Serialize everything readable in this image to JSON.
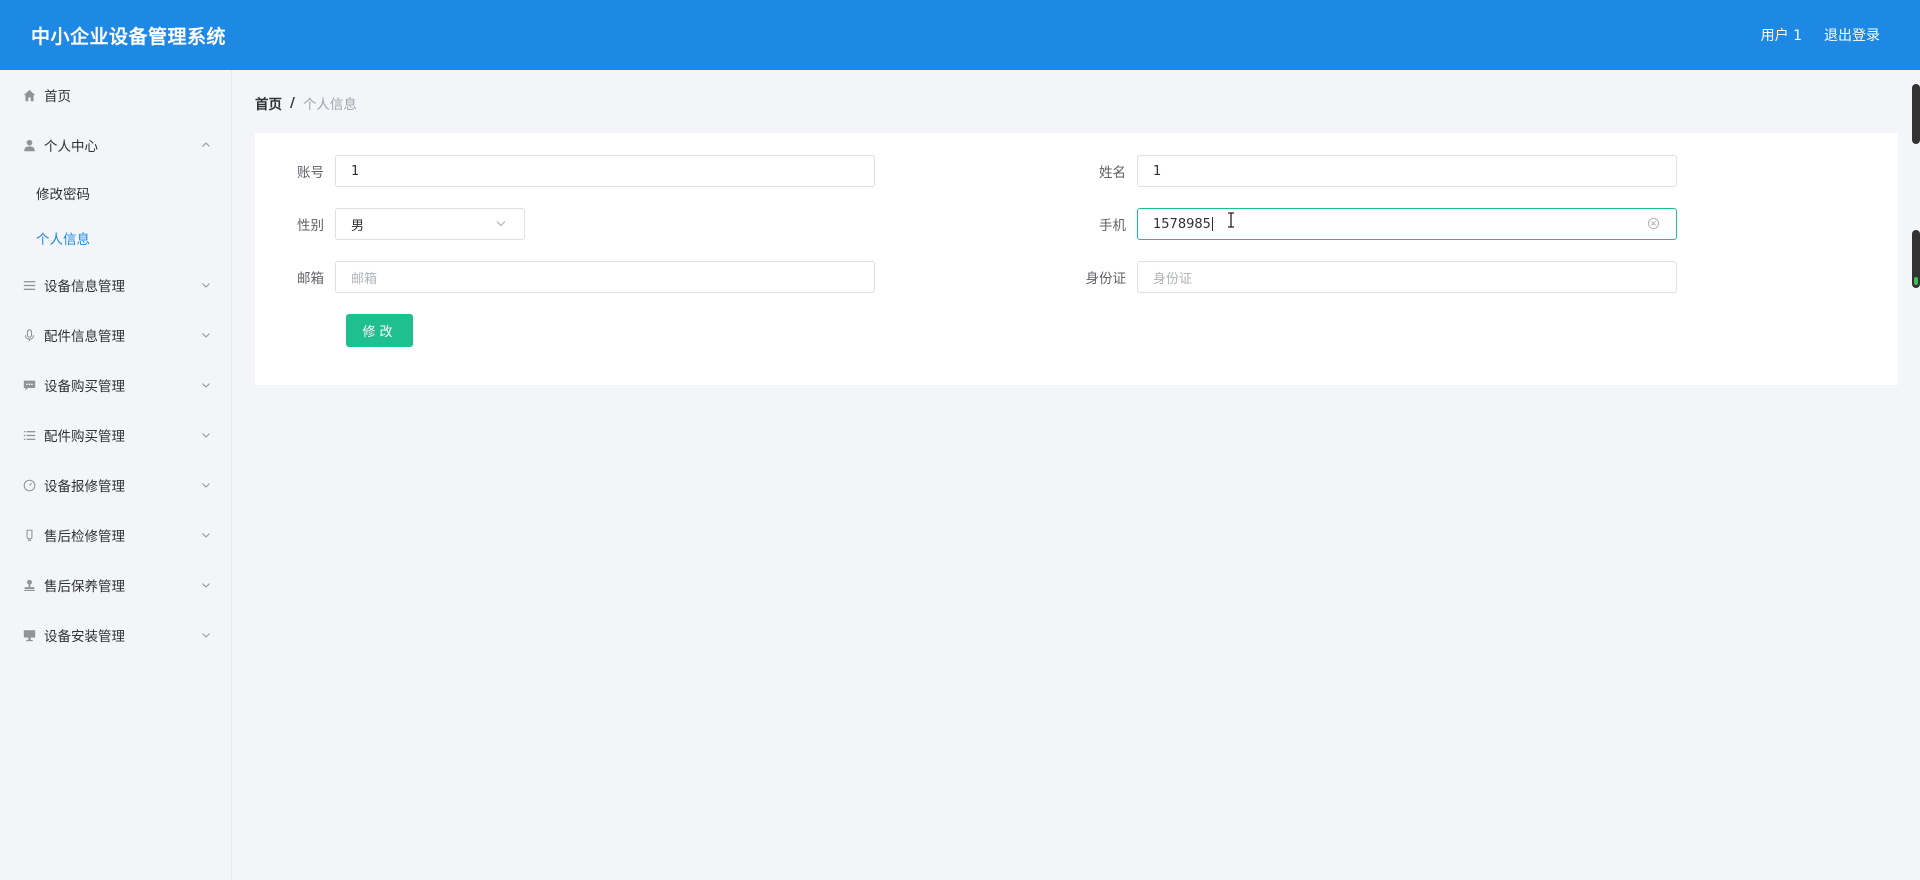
{
  "header": {
    "title": "中小企业设备管理系统",
    "user_label": "用户 1",
    "logout_label": "退出登录"
  },
  "sidebar": {
    "items": [
      {
        "label": "首页",
        "icon": "home-icon"
      },
      {
        "label": "个人中心",
        "icon": "user-icon",
        "expanded": true,
        "children": [
          {
            "label": "修改密码"
          },
          {
            "label": "个人信息",
            "active": true
          }
        ]
      },
      {
        "label": "设备信息管理",
        "icon": "menu-icon"
      },
      {
        "label": "配件信息管理",
        "icon": "microphone-icon"
      },
      {
        "label": "设备购买管理",
        "icon": "chat-icon"
      },
      {
        "label": "配件购买管理",
        "icon": "list-icon"
      },
      {
        "label": "设备报修管理",
        "icon": "clock-icon"
      },
      {
        "label": "售后检修管理",
        "icon": "bulb-icon"
      },
      {
        "label": "售后保养管理",
        "icon": "stamp-icon"
      },
      {
        "label": "设备安装管理",
        "icon": "monitor-icon"
      }
    ]
  },
  "breadcrumb": {
    "home": "首页",
    "separator": "/",
    "current": "个人信息"
  },
  "form": {
    "account": {
      "label": "账号",
      "value": "1"
    },
    "name": {
      "label": "姓名",
      "value": "1"
    },
    "gender": {
      "label": "性别",
      "value": "男"
    },
    "phone": {
      "label": "手机",
      "value": "1578985"
    },
    "email": {
      "label": "邮箱",
      "value": "",
      "placeholder": "邮箱"
    },
    "id_card": {
      "label": "身份证",
      "value": "",
      "placeholder": "身份证"
    },
    "submit_label": "修改"
  },
  "colors": {
    "header_bg": "#1e88e5",
    "accent": "#1fbf8f",
    "active_menu": "#1e88e5"
  }
}
